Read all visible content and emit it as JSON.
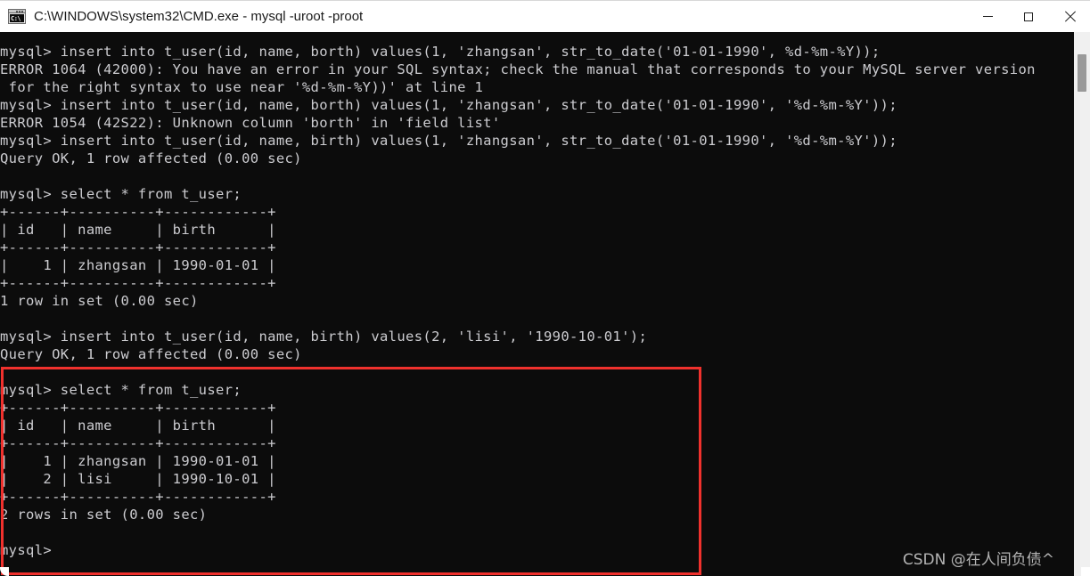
{
  "window": {
    "title": "C:\\WINDOWS\\system32\\CMD.exe - mysql  -uroot -proot",
    "icon_text": "C:\\",
    "minimize_label": "Minimize",
    "maximize_label": "Maximize",
    "close_label": "Close"
  },
  "terminal": {
    "background": "#0c0c0c",
    "foreground": "#ccccd0",
    "lines": [
      "mysql> insert into t_user(id, name, borth) values(1, 'zhangsan', str_to_date('01-01-1990', %d-%m-%Y));",
      "ERROR 1064 (42000): You have an error in your SQL syntax; check the manual that corresponds to your MySQL server version",
      " for the right syntax to use near '%d-%m-%Y))' at line 1",
      "mysql> insert into t_user(id, name, borth) values(1, 'zhangsan', str_to_date('01-01-1990', '%d-%m-%Y'));",
      "ERROR 1054 (42S22): Unknown column 'borth' in 'field list'",
      "mysql> insert into t_user(id, name, birth) values(1, 'zhangsan', str_to_date('01-01-1990', '%d-%m-%Y'));",
      "Query OK, 1 row affected (0.00 sec)",
      "",
      "mysql> select * from t_user;",
      "+------+----------+------------+",
      "| id   | name     | birth      |",
      "+------+----------+------------+",
      "|    1 | zhangsan | 1990-01-01 |",
      "+------+----------+------------+",
      "1 row in set (0.00 sec)",
      "",
      "mysql> insert into t_user(id, name, birth) values(2, 'lisi', '1990-10-01');",
      "Query OK, 1 row affected (0.00 sec)",
      "",
      "mysql> select * from t_user;",
      "+------+----------+------------+",
      "| id   | name     | birth      |",
      "+------+----------+------------+",
      "|    1 | zhangsan | 1990-01-01 |",
      "|    2 | lisi     | 1990-10-01 |",
      "+------+----------+------------+",
      "2 rows in set (0.00 sec)",
      "",
      "mysql>"
    ]
  },
  "result_tables": [
    {
      "columns": [
        "id",
        "name",
        "birth"
      ],
      "rows": [
        [
          "1",
          "zhangsan",
          "1990-01-01"
        ]
      ],
      "footer": "1 row in set (0.00 sec)"
    },
    {
      "columns": [
        "id",
        "name",
        "birth"
      ],
      "rows": [
        [
          "1",
          "zhangsan",
          "1990-01-01"
        ],
        [
          "2",
          "lisi",
          "1990-10-01"
        ]
      ],
      "footer": "2 rows in set (0.00 sec)"
    }
  ],
  "highlight": {
    "color": "#f0312d",
    "label": "highlighted-region"
  },
  "watermark": {
    "text": "CSDN @在人间负债^"
  },
  "scrollbar": {
    "track_color": "#f0f0f0",
    "thumb_color": "#9a9a9a"
  }
}
